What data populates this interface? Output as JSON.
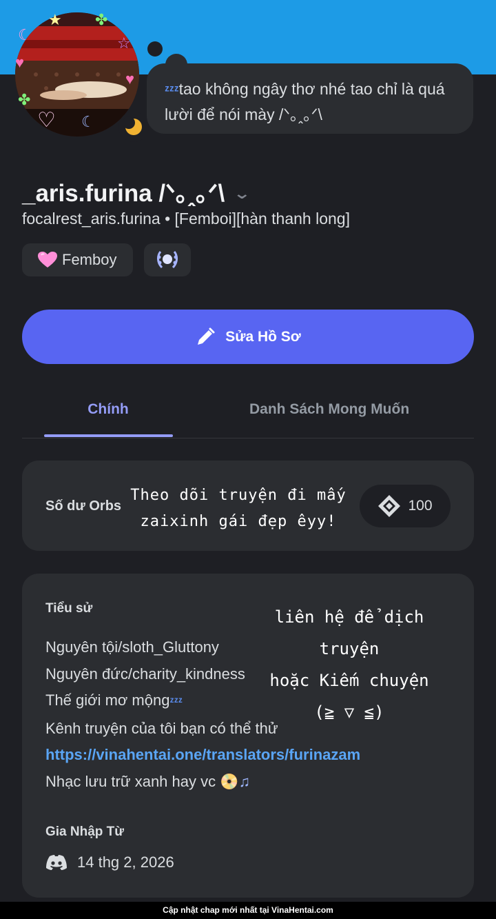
{
  "colors": {
    "banner": "#1d9be6",
    "background": "#1e1f24",
    "card": "#2b2d31",
    "accent": "#5865f2",
    "tab_active": "#949cf7",
    "link": "#5aa5f5"
  },
  "status": {
    "text": "tao không ngây thơ nhé tao chỉ là quá lười để nói mày /ᐠ｡ꞈ｡ᐟ\\",
    "emoji_icon": "zzz-icon"
  },
  "profile": {
    "display_name": "_aris.furina /ᐠ｡ꞈ｡ᐟ\\",
    "username_line": "focalrest_aris.furina • [Femboi][hàn thanh long]",
    "badges": [
      {
        "label": "Femboy",
        "icon": "pink-heart-icon"
      },
      {
        "label": "",
        "icon": "laurel-badge-icon"
      }
    ]
  },
  "edit_button": {
    "label": "Sửa Hồ Sơ",
    "icon": "pencil-icon"
  },
  "tabs": [
    {
      "label": "Chính",
      "active": true
    },
    {
      "label": "Danh Sách Mong Muốn",
      "active": false
    }
  ],
  "orbs": {
    "label": "Số dư Orbs",
    "value": "100",
    "overlay_text_line1": "Theo dõi truyện đi mấy",
    "overlay_text_line2": "zaixinh gái đẹp êyy!"
  },
  "bio": {
    "title": "Tiểu sử",
    "line1": "Nguyên tội/sloth_Gluttony",
    "line2": "Nguyên đức/charity_kindness",
    "line3": "Thế giới mơ mộng",
    "line4": "Kênh truyện của tôi bạn có thể thử",
    "link": "https://vinahentai.one/translators/furinazam",
    "line5": "Nhạc lưu trữ xanh hay vc",
    "overlay_line1": "liên hệ để dịch truyện",
    "overlay_line2": "hoặc Kiếm chuyện",
    "overlay_line3": "(≧ ▽ ≦)"
  },
  "joined": {
    "title": "Gia Nhập Từ",
    "date": "14 thg 2, 2026",
    "icon": "discord-icon"
  },
  "footer": {
    "text": "Cập nhật chap mới nhất tại VinaHentai.com"
  }
}
